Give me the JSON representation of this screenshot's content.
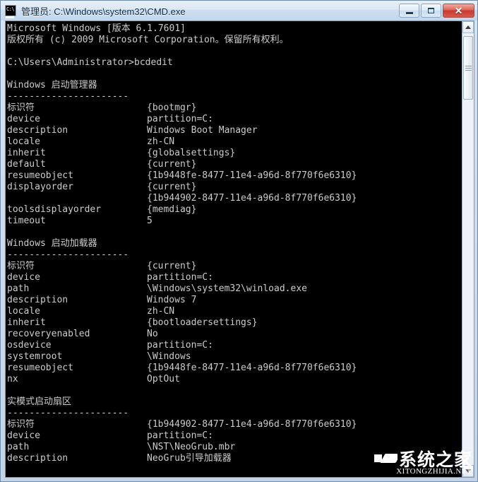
{
  "window": {
    "title": "管理员: C:\\Windows\\system32\\CMD.exe",
    "icon_glyph": "C:\\",
    "controls": {
      "minimize_label": "",
      "maximize_label": "",
      "close_label": "✕"
    }
  },
  "scrollbar": {
    "up_label": "",
    "down_label": ""
  },
  "watermark": {
    "chinese": "系统之家",
    "english": "XITONGZHIJIA.NET"
  },
  "console": {
    "lines": [
      {
        "type": "plain",
        "text": "Microsoft Windows [版本 6.1.7601]"
      },
      {
        "type": "plain",
        "text": "版权所有 (c) 2009 Microsoft Corporation。保留所有权利。"
      },
      {
        "type": "blank",
        "text": ""
      },
      {
        "type": "plain",
        "text": "C:\\Users\\Administrator>bcdedit"
      },
      {
        "type": "blank",
        "text": ""
      },
      {
        "type": "plain",
        "text": "Windows 启动管理器"
      },
      {
        "type": "plain",
        "text": "----------------------"
      },
      {
        "type": "kv",
        "key": "标识符",
        "val": "{bootmgr}"
      },
      {
        "type": "kv",
        "key": "device",
        "val": "partition=C:"
      },
      {
        "type": "kv",
        "key": "description",
        "val": "Windows Boot Manager"
      },
      {
        "type": "kv",
        "key": "locale",
        "val": "zh-CN"
      },
      {
        "type": "kv",
        "key": "inherit",
        "val": "{globalsettings}"
      },
      {
        "type": "kv",
        "key": "default",
        "val": "{current}"
      },
      {
        "type": "kv",
        "key": "resumeobject",
        "val": "{1b9448fe-8477-11e4-a96d-8f770f6e6310}"
      },
      {
        "type": "kv",
        "key": "displayorder",
        "val": "{current}"
      },
      {
        "type": "kv",
        "key": "",
        "val": "{1b944902-8477-11e4-a96d-8f770f6e6310}"
      },
      {
        "type": "kv",
        "key": "toolsdisplayorder",
        "val": "{memdiag}"
      },
      {
        "type": "kv",
        "key": "timeout",
        "val": "5"
      },
      {
        "type": "blank",
        "text": ""
      },
      {
        "type": "plain",
        "text": "Windows 启动加载器"
      },
      {
        "type": "plain",
        "text": "----------------------"
      },
      {
        "type": "kv",
        "key": "标识符",
        "val": "{current}"
      },
      {
        "type": "kv",
        "key": "device",
        "val": "partition=C:"
      },
      {
        "type": "kv",
        "key": "path",
        "val": "\\Windows\\system32\\winload.exe"
      },
      {
        "type": "kv",
        "key": "description",
        "val": "Windows 7"
      },
      {
        "type": "kv",
        "key": "locale",
        "val": "zh-CN"
      },
      {
        "type": "kv",
        "key": "inherit",
        "val": "{bootloadersettings}"
      },
      {
        "type": "kv",
        "key": "recoveryenabled",
        "val": "No"
      },
      {
        "type": "kv",
        "key": "osdevice",
        "val": "partition=C:"
      },
      {
        "type": "kv",
        "key": "systemroot",
        "val": "\\Windows"
      },
      {
        "type": "kv",
        "key": "resumeobject",
        "val": "{1b9448fe-8477-11e4-a96d-8f770f6e6310}"
      },
      {
        "type": "kv",
        "key": "nx",
        "val": "OptOut"
      },
      {
        "type": "blank",
        "text": ""
      },
      {
        "type": "plain",
        "text": "实模式启动扇区"
      },
      {
        "type": "plain",
        "text": "----------------------"
      },
      {
        "type": "kv",
        "key": "标识符",
        "val": "{1b944902-8477-11e4-a96d-8f770f6e6310}"
      },
      {
        "type": "kv",
        "key": "device",
        "val": "partition=C:"
      },
      {
        "type": "kv",
        "key": "path",
        "val": "\\NST\\NeoGrub.mbr"
      },
      {
        "type": "kv",
        "key": "description",
        "val": "NeoGrub引导加载器"
      }
    ]
  }
}
